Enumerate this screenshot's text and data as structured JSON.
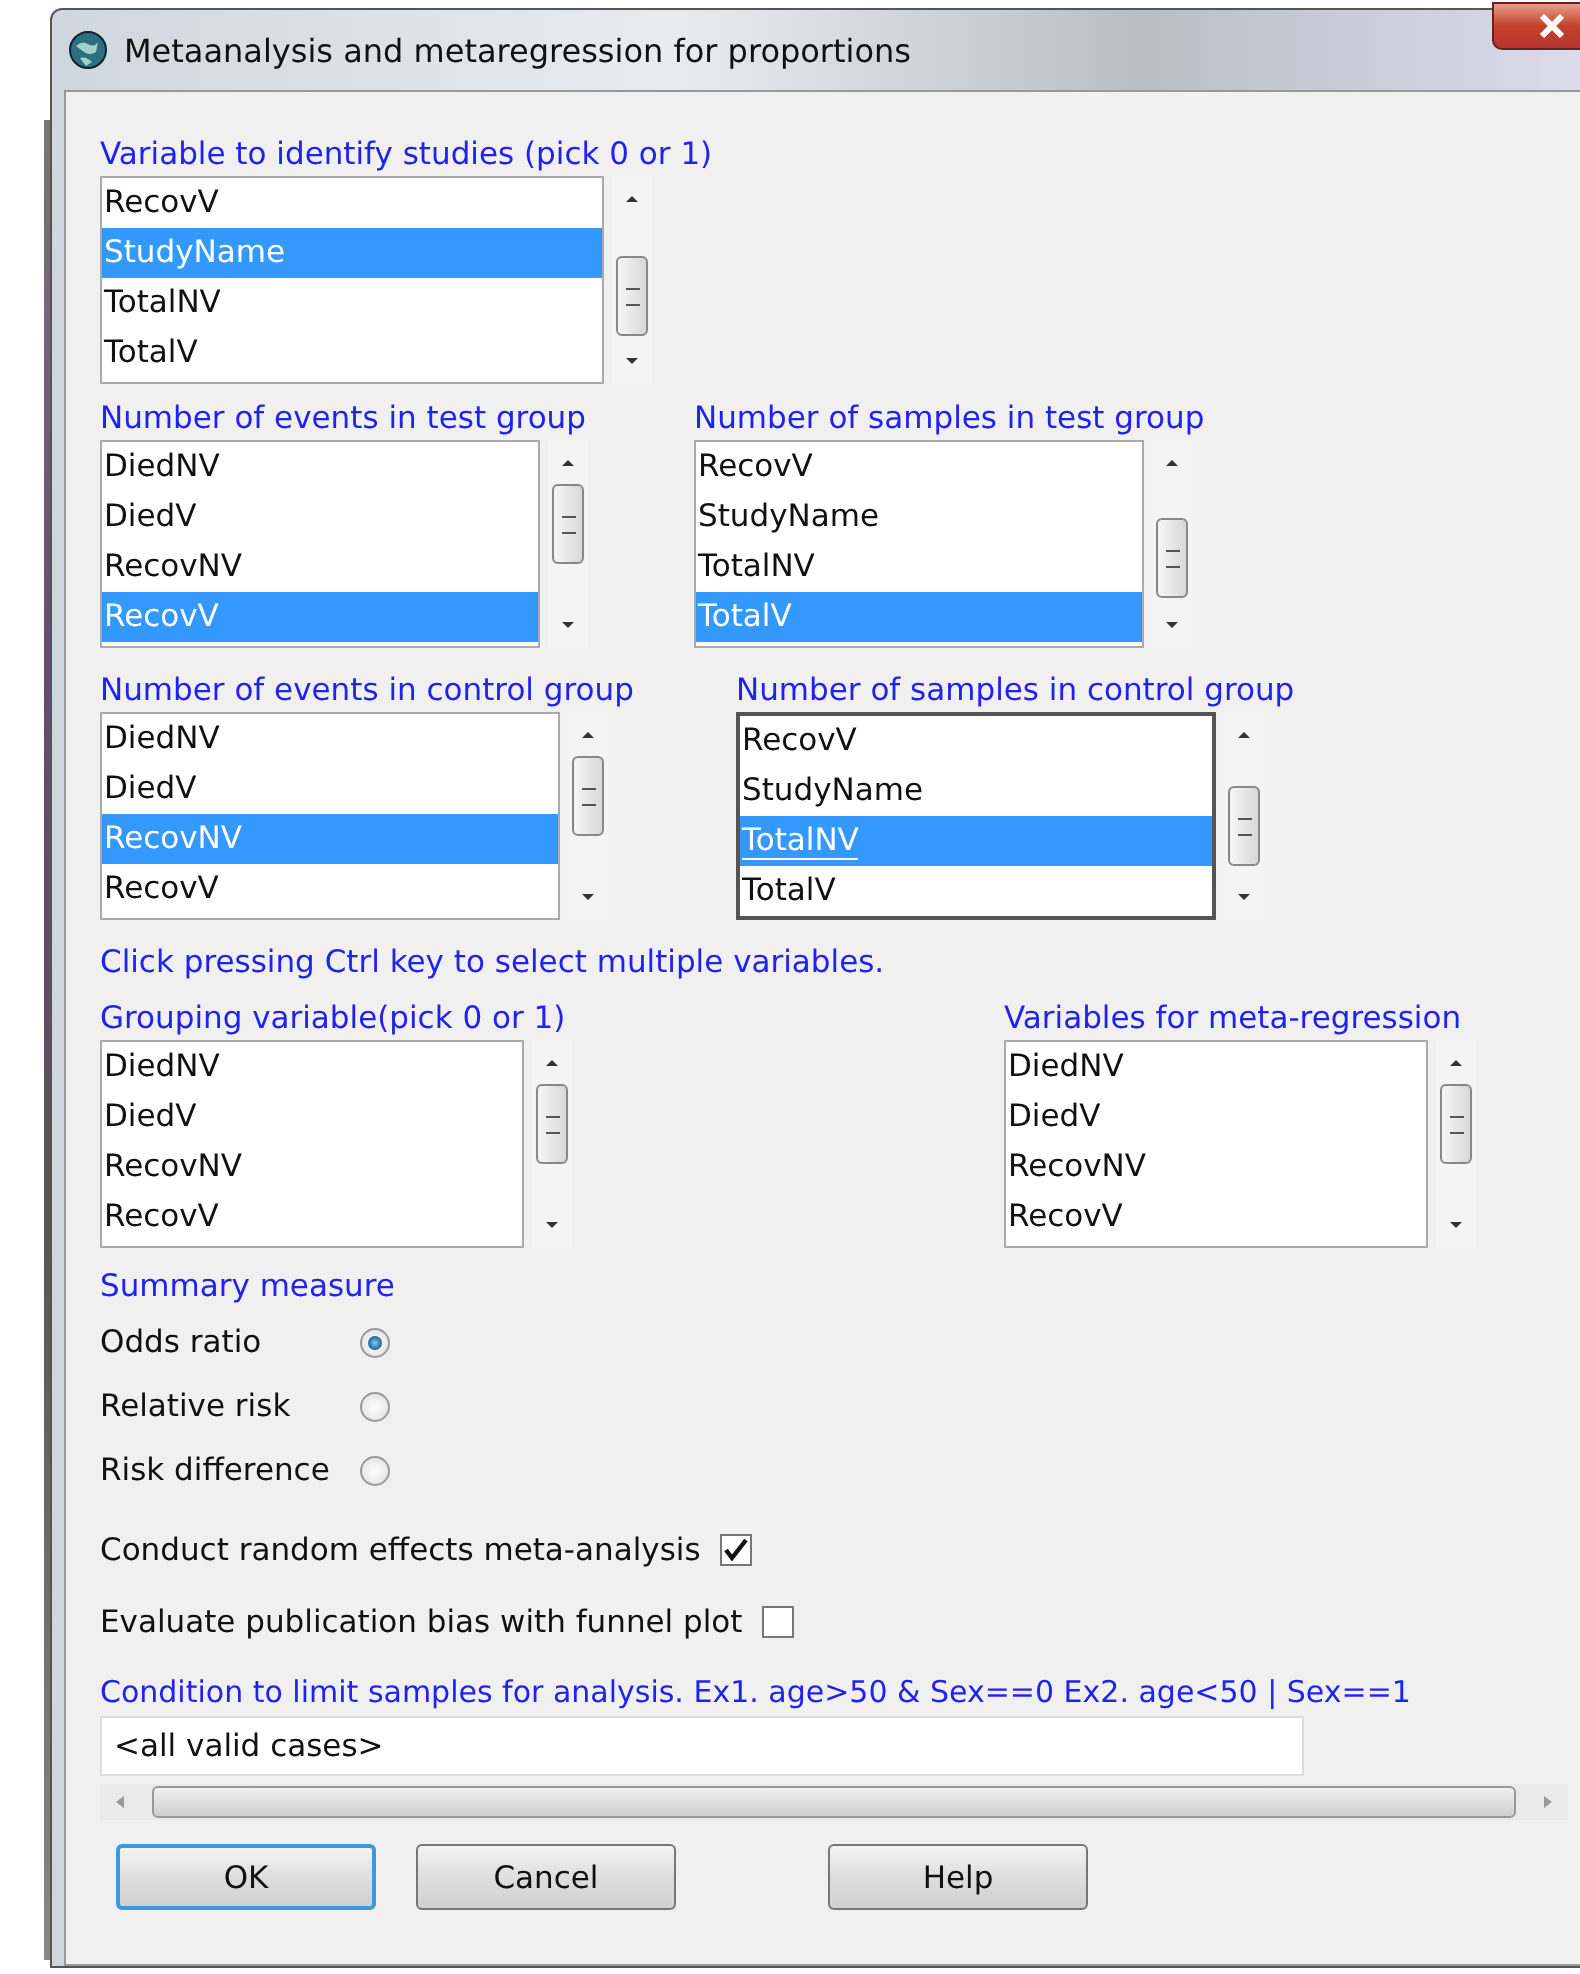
{
  "window": {
    "title": "Metaanalysis and metaregression for proportions"
  },
  "top_lists": [
    {
      "label": "Variable to identify studies (pick 0 or 1)",
      "focused": false,
      "items": [
        {
          "text": "RecovV",
          "selected": false
        },
        {
          "text": "StudyName",
          "selected": true
        },
        {
          "text": "TotalNV",
          "selected": false
        },
        {
          "text": "TotalV",
          "selected": false
        }
      ]
    }
  ],
  "test_group_lists": [
    {
      "label": "Number of events in test group",
      "focused": false,
      "items": [
        {
          "text": "DiedNV",
          "selected": false
        },
        {
          "text": "DiedV",
          "selected": false
        },
        {
          "text": "RecovNV",
          "selected": false
        },
        {
          "text": "RecovV",
          "selected": true
        }
      ]
    },
    {
      "label": "Number of samples in test group",
      "focused": false,
      "items": [
        {
          "text": "RecovV",
          "selected": false
        },
        {
          "text": "StudyName",
          "selected": false
        },
        {
          "text": "TotalNV",
          "selected": false
        },
        {
          "text": "TotalV",
          "selected": true
        }
      ]
    }
  ],
  "control_group_lists": [
    {
      "label": "Number of events in control group",
      "focused": false,
      "items": [
        {
          "text": "DiedNV",
          "selected": false
        },
        {
          "text": "DiedV",
          "selected": false
        },
        {
          "text": "RecovNV",
          "selected": true
        },
        {
          "text": "RecovV",
          "selected": false
        }
      ]
    },
    {
      "label": "Number of samples in control group",
      "focused": true,
      "items": [
        {
          "text": "RecovV",
          "selected": false
        },
        {
          "text": "StudyName",
          "selected": false
        },
        {
          "text": "TotalNV",
          "selected": true
        },
        {
          "text": "TotalV",
          "selected": false
        }
      ]
    }
  ],
  "hint": "Click pressing Ctrl key to select multiple variables.",
  "bottom_lists": [
    {
      "label": "Grouping variable(pick 0 or 1)",
      "focused": false,
      "items": [
        {
          "text": "DiedNV",
          "selected": false
        },
        {
          "text": "DiedV",
          "selected": false
        },
        {
          "text": "RecovNV",
          "selected": false
        },
        {
          "text": "RecovV",
          "selected": false
        }
      ]
    },
    {
      "label": "Variables for meta-regression",
      "focused": false,
      "items": [
        {
          "text": "DiedNV",
          "selected": false
        },
        {
          "text": "DiedV",
          "selected": false
        },
        {
          "text": "RecovNV",
          "selected": false
        },
        {
          "text": "RecovV",
          "selected": false
        }
      ]
    }
  ],
  "summary_measure": {
    "label": "Summary measure",
    "options": [
      {
        "label": "Odds ratio",
        "selected": true
      },
      {
        "label": "Relative risk",
        "selected": false
      },
      {
        "label": "Risk difference",
        "selected": false
      }
    ]
  },
  "checkboxes": [
    {
      "label": "Conduct random effects meta-analysis",
      "checked": true
    },
    {
      "label": "Evaluate publication bias with funnel plot",
      "checked": false
    }
  ],
  "condition": {
    "label": "Condition to limit samples for analysis. Ex1. age>50 & Sex==0  Ex2. age<50 | Sex==1",
    "value": "<all valid cases>"
  },
  "buttons": [
    {
      "label": "OK",
      "default": true
    },
    {
      "label": "Cancel",
      "default": false
    },
    {
      "label": "Help",
      "default": false
    }
  ]
}
